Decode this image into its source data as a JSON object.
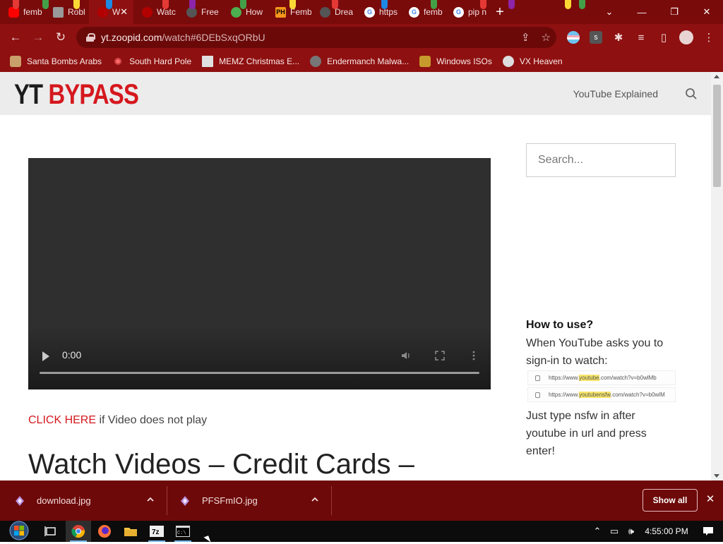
{
  "browser": {
    "tabs": [
      {
        "title": "femb",
        "icon": "youtube-icon",
        "color": "#ff0000"
      },
      {
        "title": "Robl",
        "icon": "roblox-icon",
        "color": "#9a9a9a"
      },
      {
        "title": "W",
        "icon": "red-logo-icon",
        "color": "#b30000"
      },
      {
        "title": "Watc",
        "icon": "red-logo-icon",
        "color": "#b30000"
      },
      {
        "title": "Free",
        "icon": "creature-icon",
        "color": "#555555"
      },
      {
        "title": "How",
        "icon": "green-circle-icon",
        "color": "#4caf50"
      },
      {
        "title": "Femb",
        "icon": "ph-icon",
        "color": "#f7971d"
      },
      {
        "title": "Drea",
        "icon": "creature-icon",
        "color": "#555555"
      },
      {
        "title": "https",
        "icon": "google-icon",
        "color": "#4285f4"
      },
      {
        "title": "femb",
        "icon": "google-icon",
        "color": "#4285f4"
      },
      {
        "title": "pip n",
        "icon": "google-icon",
        "color": "#4285f4"
      }
    ],
    "active_tab_index": 2,
    "url_host": "yt.zoopid.com",
    "url_path": "/watch#6DEbSxqORbU",
    "bookmarks": [
      {
        "label": "Santa Bombs Arabs",
        "icon": "candle-icon",
        "color": "#c9a06a"
      },
      {
        "label": "South Hard Pole",
        "icon": "snowflake-icon",
        "color": "#c62828"
      },
      {
        "label": "MEMZ Christmas E...",
        "icon": "document-icon",
        "color": "#e0e0e0"
      },
      {
        "label": "Endermanch Malwa...",
        "icon": "creature-icon",
        "color": "#777777"
      },
      {
        "label": "Windows ISOs",
        "icon": "trophy-icon",
        "color": "#c79a2e"
      },
      {
        "label": "VX Heaven",
        "icon": "skull-icon",
        "color": "#dddddd"
      }
    ]
  },
  "site": {
    "logo_left": "YT",
    "logo_right": "BYPASS",
    "nav_link": "YouTube Explained",
    "search_placeholder": "Search...",
    "video_time": "0:00",
    "click_here": "CLICK HERE",
    "click_here_rest": " if Video does not play",
    "headline": "Watch Videos – Credit Cards –",
    "howto_title": "How to use?",
    "howto_line1": "When YouTube asks you to sign-in to watch:",
    "howto_url1_pre": "https://www.",
    "howto_url1_hl": "youtube",
    "howto_url1_post": ".com/watch?v=b0wlMb",
    "howto_url2_pre": "https://www.",
    "howto_url2_hl": "youtubensfw",
    "howto_url2_post": ".com/watch?v=b0wlM",
    "howto_line2": "Just type nsfw in after youtube in url and press enter!"
  },
  "downloads": {
    "items": [
      {
        "filename": "download.jpg"
      },
      {
        "filename": "PFSFmIO.jpg"
      }
    ],
    "show_all": "Show all"
  },
  "taskbar": {
    "clock": "4:55:00 PM",
    "apps": [
      "task-view-icon",
      "chrome-icon",
      "firefox-icon",
      "file-explorer-icon",
      "7zip-icon",
      "cmd-icon"
    ]
  },
  "colors": {
    "browser_frame": "#8e1010",
    "accent_red": "#d5181e",
    "download_bar": "#6d0909"
  }
}
